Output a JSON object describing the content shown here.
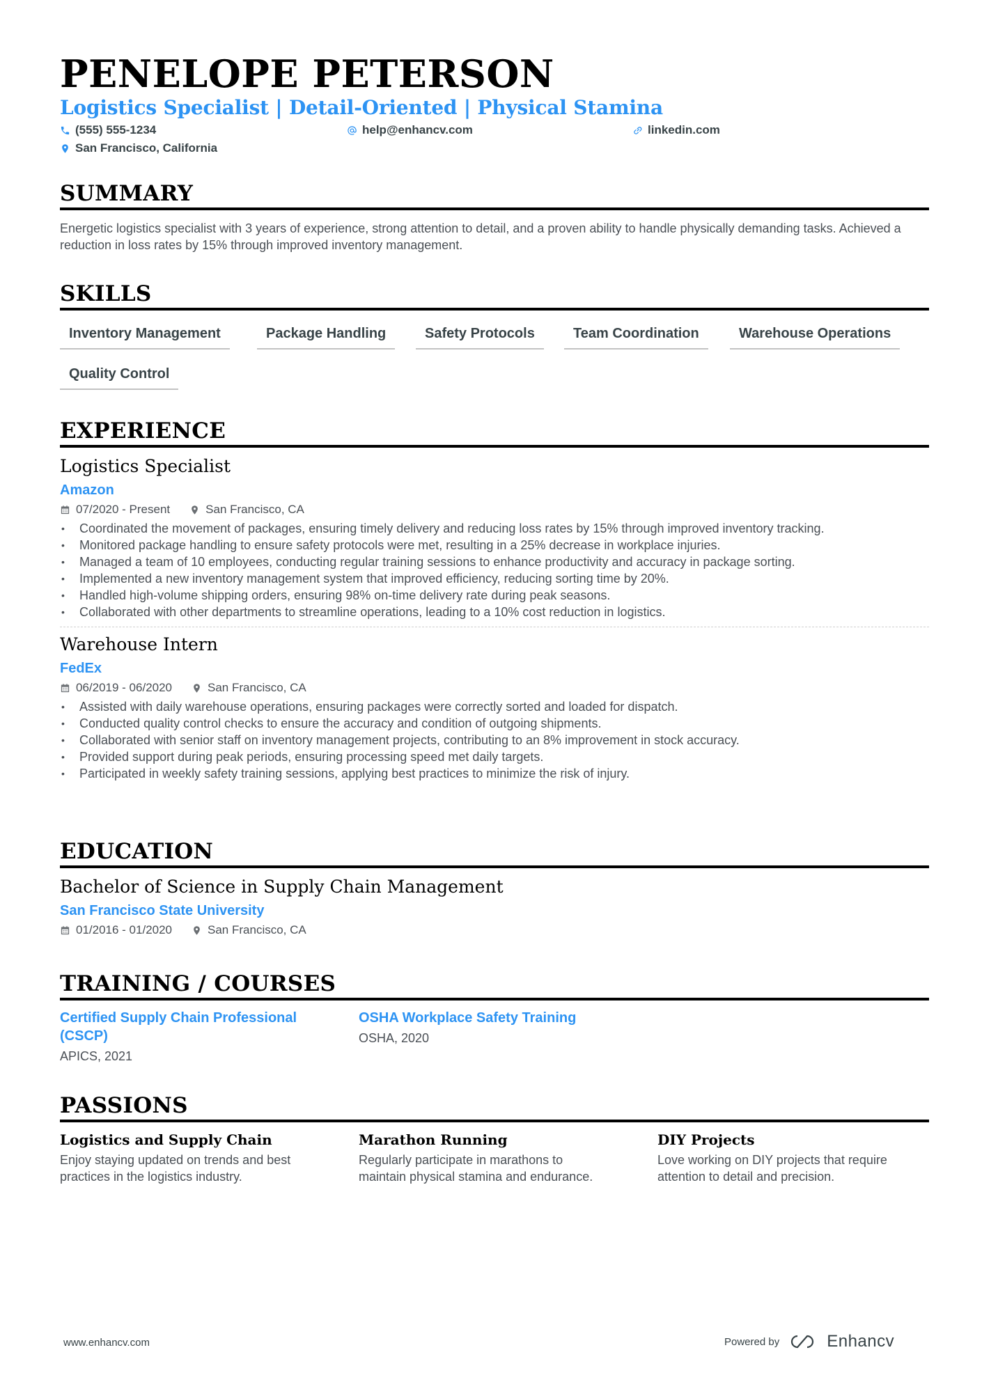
{
  "header": {
    "name": "PENELOPE PETERSON",
    "headline": "Logistics Specialist | Detail-Oriented | Physical Stamina",
    "contact": {
      "phone": "(555) 555-1234",
      "email": "help@enhancv.com",
      "link": "linkedin.com",
      "location": "San Francisco, California"
    },
    "icons": {
      "phone": "phone-icon",
      "email": "at-icon",
      "link": "link-icon",
      "location": "map-pin-icon"
    }
  },
  "summary": {
    "title": "SUMMARY",
    "text": "Energetic logistics specialist with 3 years of experience, strong attention to detail, and a proven ability to handle physically demanding tasks. Achieved a reduction in loss rates by 15% through improved inventory management."
  },
  "skills": {
    "title": "SKILLS",
    "items": [
      "Inventory Management",
      "Package Handling",
      "Safety Protocols",
      "Team Coordination",
      "Warehouse Operations",
      "Quality Control"
    ]
  },
  "experience": {
    "title": "EXPERIENCE",
    "jobs": [
      {
        "title": "Logistics Specialist",
        "company": "Amazon",
        "dates": "07/2020 - Present",
        "location": "San Francisco, CA",
        "bullets": [
          "Coordinated the movement of packages, ensuring timely delivery and reducing loss rates by 15% through improved inventory tracking.",
          "Monitored package handling to ensure safety protocols were met, resulting in a 25% decrease in workplace injuries.",
          "Managed a team of 10 employees, conducting regular training sessions to enhance productivity and accuracy in package sorting.",
          "Implemented a new inventory management system that improved efficiency, reducing sorting time by 20%.",
          "Handled high-volume shipping orders, ensuring 98% on-time delivery rate during peak seasons.",
          "Collaborated with other departments to streamline operations, leading to a 10% cost reduction in logistics."
        ]
      },
      {
        "title": "Warehouse Intern",
        "company": "FedEx",
        "dates": "06/2019 - 06/2020",
        "location": "San Francisco, CA",
        "bullets": [
          "Assisted with daily warehouse operations, ensuring packages were correctly sorted and loaded for dispatch.",
          "Conducted quality control checks to ensure the accuracy and condition of outgoing shipments.",
          "Collaborated with senior staff on inventory management projects, contributing to an 8% improvement in stock accuracy.",
          "Provided support during peak periods, ensuring processing speed met daily targets.",
          "Participated in weekly safety training sessions, applying best practices to minimize the risk of injury."
        ]
      }
    ]
  },
  "education": {
    "title": "EDUCATION",
    "degree": "Bachelor of Science in Supply Chain Management",
    "school": "San Francisco State University",
    "dates": "01/2016 - 01/2020",
    "location": "San Francisco, CA"
  },
  "training": {
    "title": "TRAINING / COURSES",
    "items": [
      {
        "title_line1": "Certified Supply Chain Professional",
        "title_line2": "(CSCP)",
        "sub": "APICS, 2021"
      },
      {
        "title_line1": "OSHA Workplace Safety Training",
        "title_line2": "",
        "sub": "OSHA, 2020"
      }
    ]
  },
  "passions": {
    "title": "PASSIONS",
    "items": [
      {
        "title": "Logistics and Supply Chain",
        "line1": "Enjoy staying updated on trends and best",
        "line2": "practices in the logistics industry."
      },
      {
        "title": "Marathon Running",
        "line1": "Regularly participate in marathons to",
        "line2": "maintain physical stamina and endurance."
      },
      {
        "title": "DIY Projects",
        "line1": "Love working on DIY projects that require",
        "line2": "attention to detail and precision."
      }
    ]
  },
  "footer": {
    "website": "www.enhancv.com",
    "powered_by": "Powered by",
    "brand": "Enhancv"
  },
  "colors": {
    "accent": "#2d93f3",
    "heading": "#000000",
    "text": "#4a4f55"
  }
}
